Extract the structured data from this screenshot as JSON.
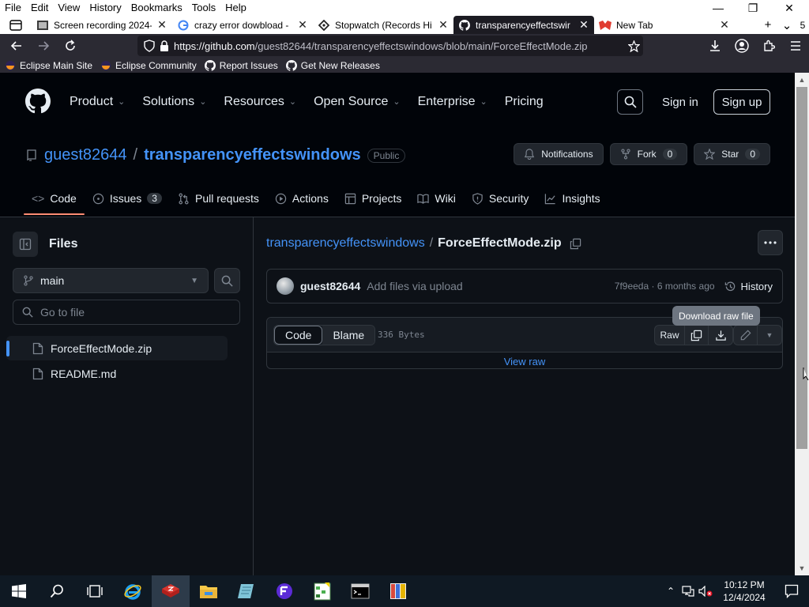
{
  "menubar": {
    "items": [
      "File",
      "Edit",
      "View",
      "History",
      "Bookmarks",
      "Tools",
      "Help"
    ],
    "minimize": "—",
    "maximize": "❐",
    "close": "✕"
  },
  "tabs": [
    {
      "title": "Screen recording 2024-",
      "favicon": "video-recording-icon",
      "active": false
    },
    {
      "title": "crazy error dowbload -",
      "favicon": "google-icon",
      "active": false
    },
    {
      "title": "Stopwatch (Records Hi",
      "favicon": "stopwatch-icon",
      "active": false
    },
    {
      "title": "transparencyeffectswir",
      "favicon": "github-icon",
      "active": true
    },
    {
      "title": "New Tab",
      "favicon": "new-tab-icon",
      "active": false
    }
  ],
  "tabbar": {
    "new_tab": "+",
    "list_all": "⌄",
    "tab_count": "5"
  },
  "navbar": {
    "url_prefix": "https://",
    "url_host": "github.com",
    "url_path": "/guest82644/transparencyeffectswindows/blob/main/ForceEffectMode.zip"
  },
  "bookmarks": [
    {
      "label": "Eclipse Main Site",
      "icon": "eclipse-icon"
    },
    {
      "label": "Eclipse Community",
      "icon": "eclipse-icon"
    },
    {
      "label": "Report Issues",
      "icon": "github-icon"
    },
    {
      "label": "Get New Releases",
      "icon": "github-icon"
    }
  ],
  "gh_header": {
    "nav": [
      "Product",
      "Solutions",
      "Resources",
      "Open Source",
      "Enterprise",
      "Pricing"
    ],
    "sign_in": "Sign in",
    "sign_up": "Sign up"
  },
  "repo": {
    "owner": "guest82644",
    "separator": "/",
    "name": "transparencyeffectswindows",
    "visibility": "Public",
    "notifications_label": "Notifications",
    "fork_label": "Fork",
    "fork_count": "0",
    "star_label": "Star",
    "star_count": "0",
    "tabs": [
      {
        "label": "Code",
        "icon": "code-icon",
        "count": ""
      },
      {
        "label": "Issues",
        "icon": "issue-icon",
        "count": "3"
      },
      {
        "label": "Pull requests",
        "icon": "pull-request-icon",
        "count": ""
      },
      {
        "label": "Actions",
        "icon": "play-icon",
        "count": ""
      },
      {
        "label": "Projects",
        "icon": "table-icon",
        "count": ""
      },
      {
        "label": "Wiki",
        "icon": "book-icon",
        "count": ""
      },
      {
        "label": "Security",
        "icon": "shield-icon",
        "count": ""
      },
      {
        "label": "Insights",
        "icon": "graph-icon",
        "count": ""
      }
    ]
  },
  "sidebar": {
    "title": "Files",
    "branch": "main",
    "goto_placeholder": "Go to file",
    "files": [
      {
        "name": "ForceEffectMode.zip",
        "selected": true
      },
      {
        "name": "README.md",
        "selected": false
      }
    ]
  },
  "content": {
    "crumb_repo": "transparencyeffectswindows",
    "crumb_sep": "/",
    "crumb_file": "ForceEffectMode.zip",
    "commit_user": "guest82644",
    "commit_message": "Add files via upload",
    "commit_meta": "7f9eeda · 6 months ago",
    "history_label": "History",
    "tooltip": "Download raw file",
    "seg_code": "Code",
    "seg_blame": "Blame",
    "file_size": "336 Bytes",
    "raw_label": "Raw",
    "view_raw": "View raw"
  },
  "taskbar": {
    "apps": [
      "start-icon",
      "search-icon",
      "task-view-icon",
      "internet-explorer-icon",
      "filezilla-icon",
      "file-explorer-icon",
      "notepad-icon",
      "setup-icon",
      "spreadsheet-icon",
      "terminal-icon",
      "archive-icon"
    ],
    "time": "10:12 PM",
    "date": "12/4/2024"
  }
}
